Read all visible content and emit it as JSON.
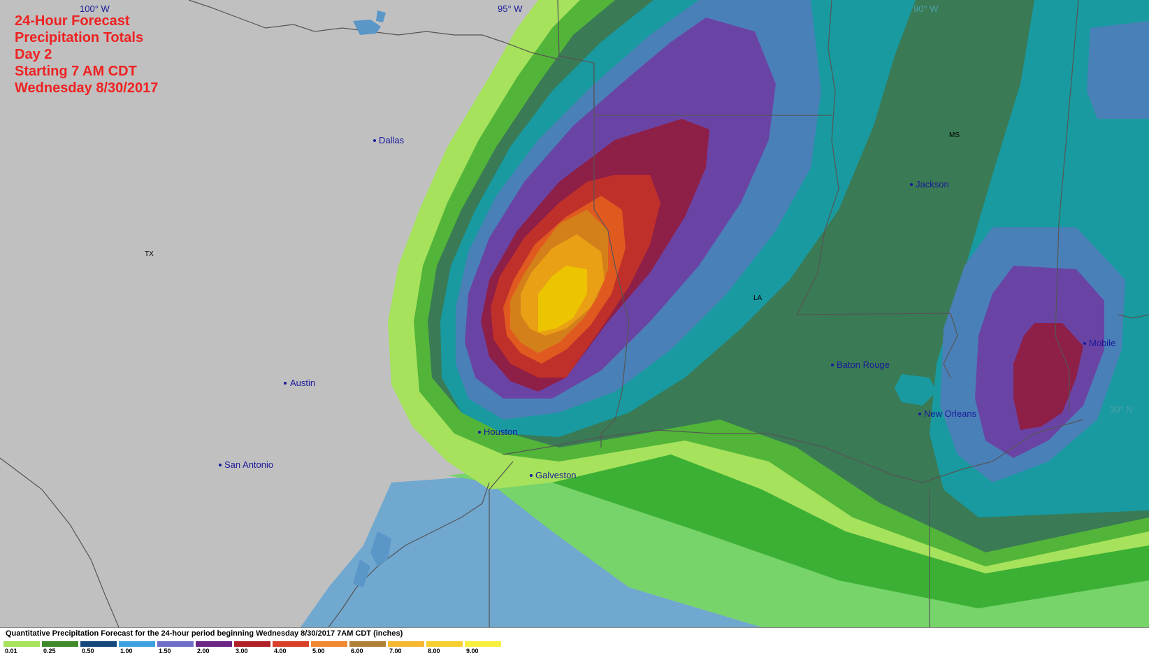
{
  "title_lines": [
    "24-Hour Forecast",
    "Precipitation Totals",
    "Day 2",
    "Starting 7 AM CDT",
    "Wednesday 8/30/2017"
  ],
  "longitude_labels": [
    "100° W",
    "95° W",
    "90° W"
  ],
  "latitude_labels": [
    "30° N"
  ],
  "state_labels": [
    "TX",
    "LA",
    "MS"
  ],
  "cities": [
    {
      "name": "Dallas"
    },
    {
      "name": "Austin"
    },
    {
      "name": "San Antonio"
    },
    {
      "name": "Houston"
    },
    {
      "name": "Galveston"
    },
    {
      "name": "Jackson"
    },
    {
      "name": "Baton Rouge"
    },
    {
      "name": "New Orleans"
    },
    {
      "name": "Mobile"
    }
  ],
  "legend": {
    "title": "Quantitative Precipitation Forecast for the 24-hour period beginning Wednesday 8/30/2017 7AM CDT (inches)",
    "bins": [
      {
        "label": "0.01",
        "color": "#a6e25c"
      },
      {
        "label": "0.25",
        "color": "#3f8a2a"
      },
      {
        "label": "0.50",
        "color": "#15487a"
      },
      {
        "label": "1.00",
        "color": "#3fa0e0"
      },
      {
        "label": "1.50",
        "color": "#6d6fc8"
      },
      {
        "label": "2.00",
        "color": "#6a2585"
      },
      {
        "label": "3.00",
        "color": "#b02028"
      },
      {
        "label": "4.00",
        "color": "#d8402a"
      },
      {
        "label": "5.00",
        "color": "#f08830"
      },
      {
        "label": "6.00",
        "color": "#b08038"
      },
      {
        "label": "7.00",
        "color": "#f5b830"
      },
      {
        "label": "8.00",
        "color": "#f5d030"
      },
      {
        "label": "9.00",
        "color": "#f8f040"
      }
    ]
  },
  "colors": {
    "land": "#c0c0c0",
    "gulf": "#70a8d0",
    "band_0_01": "#a6e25c",
    "band_0_25": "#52b539",
    "band_0_50": "#3a7a55",
    "band_1_00": "#189aa0",
    "band_1_50": "#4a80b8",
    "band_2_00": "#6a44a5",
    "band_3_00": "#8e1f47",
    "band_4_00": "#c0302a",
    "band_5_00": "#e05a20",
    "band_6_00": "#d4801a",
    "band_7_00": "#eaa014",
    "band_8_00": "#ecc400",
    "gulf_green_light": "#76d46a",
    "gulf_green": "#3cb034",
    "title_red": "#ee2222",
    "label_blue": "#1a1a99"
  }
}
